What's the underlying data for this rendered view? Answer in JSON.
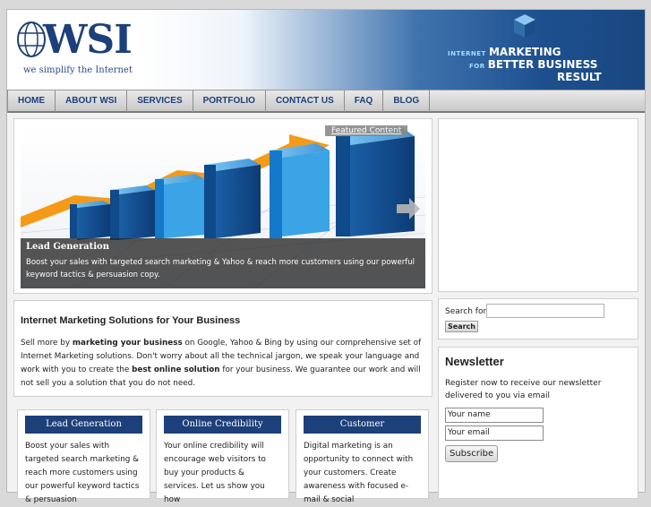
{
  "header": {
    "logo_text": "WSI",
    "logo_tagline": "we simplify the Internet",
    "slogan": {
      "l1_small": "INTERNET",
      "l1_big": "MARKETING",
      "l2_small": "FOR",
      "l2_big": "BETTER BUSINESS",
      "l3_big": "RESULT"
    }
  },
  "nav": {
    "items": [
      {
        "label": "HOME"
      },
      {
        "label": "ABOUT WSI"
      },
      {
        "label": "SERVICES"
      },
      {
        "label": "PORTFOLIO"
      },
      {
        "label": "CONTACT US"
      },
      {
        "label": "FAQ"
      },
      {
        "label": "BLOG"
      }
    ]
  },
  "featured": {
    "tag": "Featured Content",
    "title": "Lead Generation",
    "desc": "Boost your sales with targeted search marketing & Yahoo & reach more customers using our powerful keyword tactics & persuasion copy."
  },
  "intro": {
    "heading": "Internet Marketing Solutions for Your Business",
    "p1": "Sell more by ",
    "p1_b": "marketing your business",
    "p2": " on Google, Yahoo & Bing by using our comprehensive set of Internet Marketing solutions. Don't worry about all the technical jargon, we speak your language and work with you to create the ",
    "p2_b": "best online solution",
    "p3": " for your business. We guarantee our work and will not sell you a solution that you do not need."
  },
  "boxes": [
    {
      "title": "Lead Generation",
      "text": "Boost your sales with targeted search marketing & reach more customers using our powerful keyword tactics & persuasion"
    },
    {
      "title": "Online Credibility",
      "text": "Your online credibility will encourage web visitors to buy your products & services. Let us show you how"
    },
    {
      "title": "Customer Communication",
      "text": "Digital marketing is an opportunity to connect with your customers. Create awareness with focused e-mail & social"
    }
  ],
  "sidebar": {
    "search_label": "Search for:",
    "search_button": "Search",
    "newsletter_title": "Newsletter",
    "newsletter_desc": "Register now to receive our newsletter delivered to you via email",
    "name_value": "Your name",
    "email_value": "Your email",
    "subscribe_label": "Subscribe"
  },
  "colors": {
    "brand_blue": "#1d3f7a",
    "banner_blue": "#19477f"
  }
}
